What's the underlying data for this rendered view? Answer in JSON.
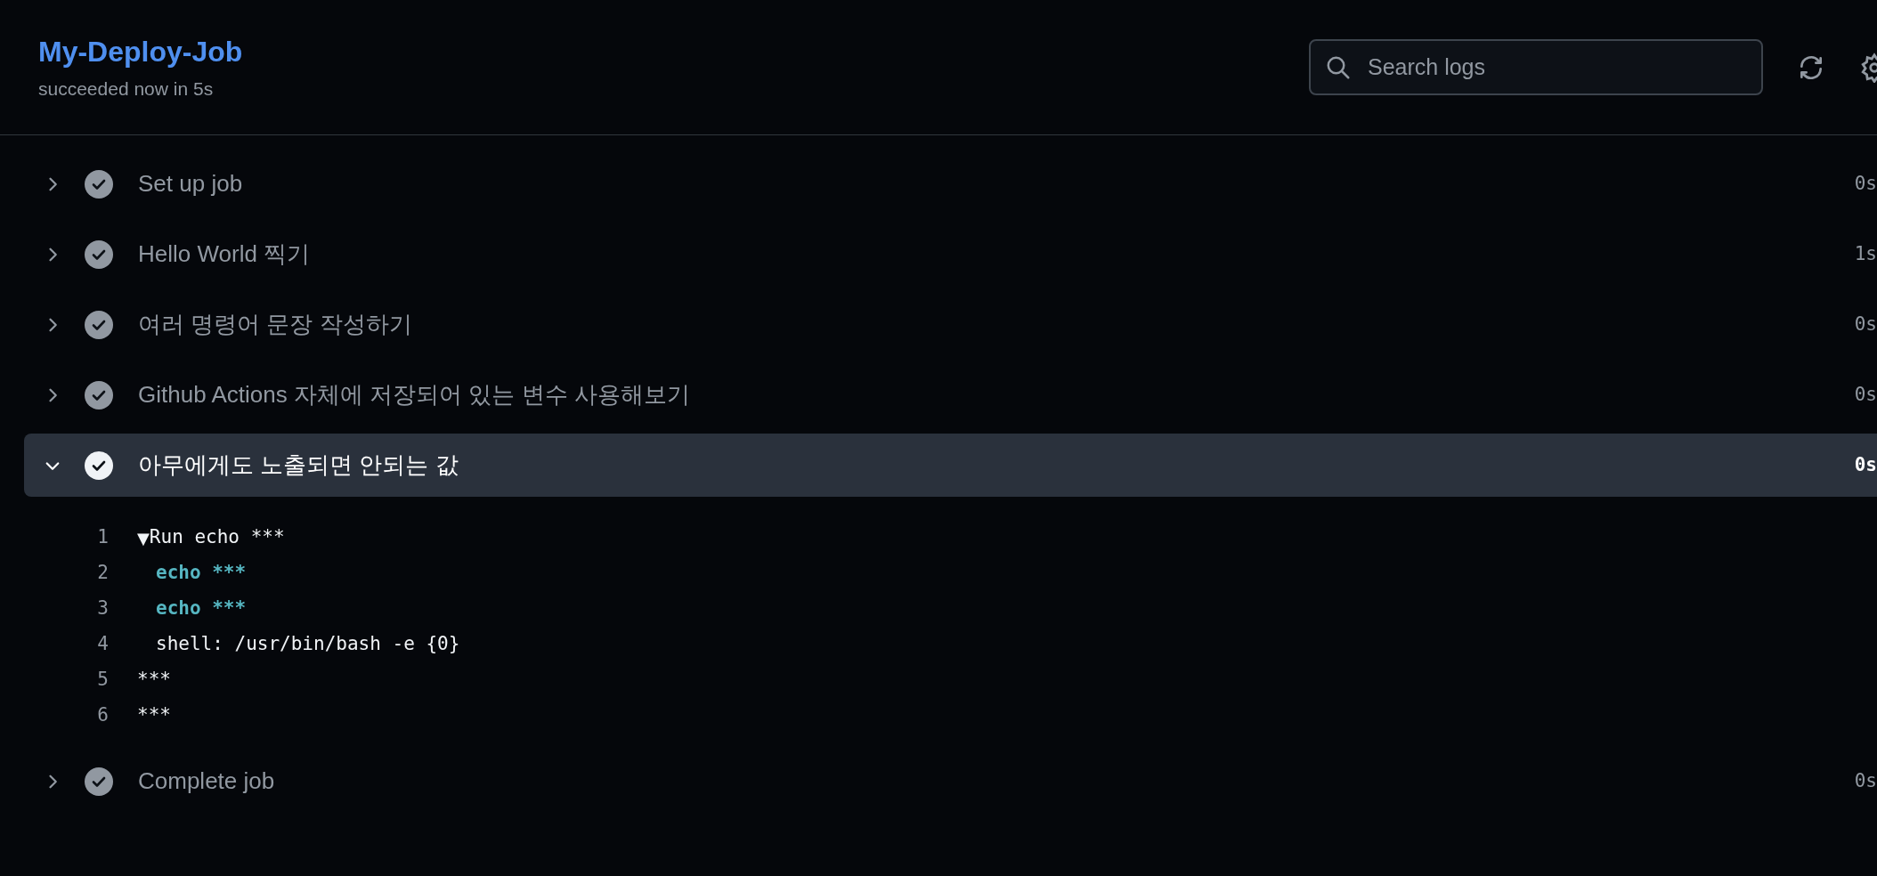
{
  "job": {
    "title": "My-Deploy-Job",
    "subtitle": "succeeded now in 5s"
  },
  "search": {
    "placeholder": "Search logs"
  },
  "steps": [
    {
      "name": "Set up job",
      "duration": "0s",
      "kind": "success",
      "expanded": false
    },
    {
      "name": "Hello World 찍기",
      "duration": "1s",
      "kind": "success",
      "expanded": false
    },
    {
      "name": "여러 명령어 문장 작성하기",
      "duration": "0s",
      "kind": "success",
      "expanded": false
    },
    {
      "name": "Github Actions 자체에 저장되어 있는 변수 사용해보기",
      "duration": "0s",
      "kind": "success",
      "expanded": false
    },
    {
      "name": "아무에게도 노출되면 안되는 값",
      "duration": "0s",
      "kind": "success",
      "expanded": true,
      "log": [
        {
          "number": "1",
          "kind": "group",
          "marker": "▼",
          "text": "Run echo ***"
        },
        {
          "number": "2",
          "kind": "command",
          "text": "echo ***"
        },
        {
          "number": "3",
          "kind": "command",
          "text": "echo ***"
        },
        {
          "number": "4",
          "kind": "detail",
          "text": "shell: /usr/bin/bash -e {0}"
        },
        {
          "number": "5",
          "kind": "output",
          "text": "***"
        },
        {
          "number": "6",
          "kind": "output",
          "text": "***"
        }
      ]
    },
    {
      "name": "Complete job",
      "duration": "0s",
      "kind": "success",
      "expanded": false
    }
  ]
}
